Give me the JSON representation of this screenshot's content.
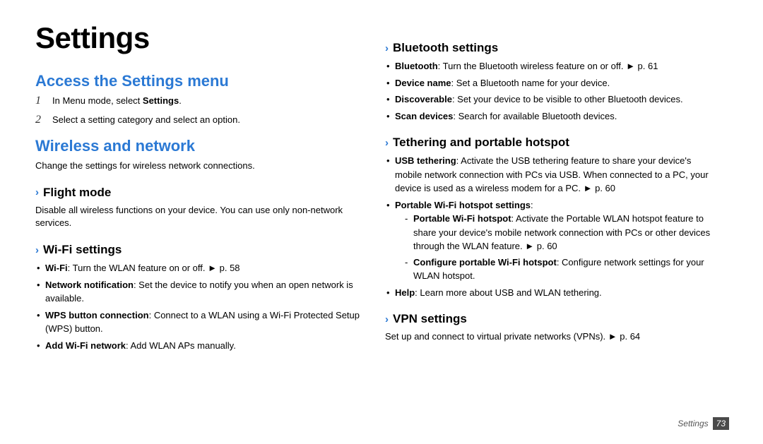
{
  "title": "Settings",
  "footer": {
    "section": "Settings",
    "page": "73"
  },
  "left": {
    "access": {
      "heading": "Access the Settings menu",
      "step1_num": "1",
      "step1_a": "In Menu mode, select ",
      "step1_b": "Settings",
      "step1_c": ".",
      "step2_num": "2",
      "step2": "Select a setting category and select an option."
    },
    "wireless": {
      "heading": "Wireless and network",
      "intro": "Change the settings for wireless network connections.",
      "flight": {
        "heading": "Flight mode",
        "text": "Disable all wireless functions on your device. You can use only non-network services."
      },
      "wifi": {
        "heading": "Wi-Fi settings",
        "i1a": "Wi-Fi",
        "i1b": ": Turn the WLAN feature on or off. ",
        "i1c": "► p. 58",
        "i2a": "Network notification",
        "i2b": ": Set the device to notify you when an open network is available.",
        "i3a": "WPS button connection",
        "i3b": ": Connect to a WLAN using a Wi-Fi Protected Setup (WPS) button.",
        "i4a": "Add Wi-Fi network",
        "i4b": ": Add WLAN APs manually."
      }
    }
  },
  "right": {
    "bt": {
      "heading": "Bluetooth settings",
      "i1a": "Bluetooth",
      "i1b": ": Turn the Bluetooth wireless feature on or off. ",
      "i1c": "► p. 61",
      "i2a": "Device name",
      "i2b": ": Set a Bluetooth name for your device.",
      "i3a": "Discoverable",
      "i3b": ": Set your device to be visible to other Bluetooth devices.",
      "i4a": "Scan devices",
      "i4b": ": Search for available Bluetooth devices."
    },
    "tether": {
      "heading": "Tethering and portable hotspot",
      "i1a": "USB tethering",
      "i1b": ": Activate the USB tethering feature to share your device's mobile network connection with PCs via USB. When connected to a PC, your device is used as a wireless modem for a PC. ",
      "i1c": "► p. 60",
      "i2a": "Portable Wi-Fi hotspot settings",
      "i2b": ":",
      "s1a": "Portable Wi-Fi hotspot",
      "s1b": ": Activate the Portable WLAN hotspot feature to share your device's mobile network connection with PCs or other devices through the WLAN feature. ",
      "s1c": "► p. 60",
      "s2a": "Configure portable Wi-Fi hotspot",
      "s2b": ": Configure network settings for your WLAN hotspot.",
      "i3a": "Help",
      "i3b": ": Learn more about USB and WLAN tethering."
    },
    "vpn": {
      "heading": "VPN settings",
      "text_a": "Set up and connect to virtual private networks (VPNs). ",
      "text_b": "► p. 64"
    }
  }
}
